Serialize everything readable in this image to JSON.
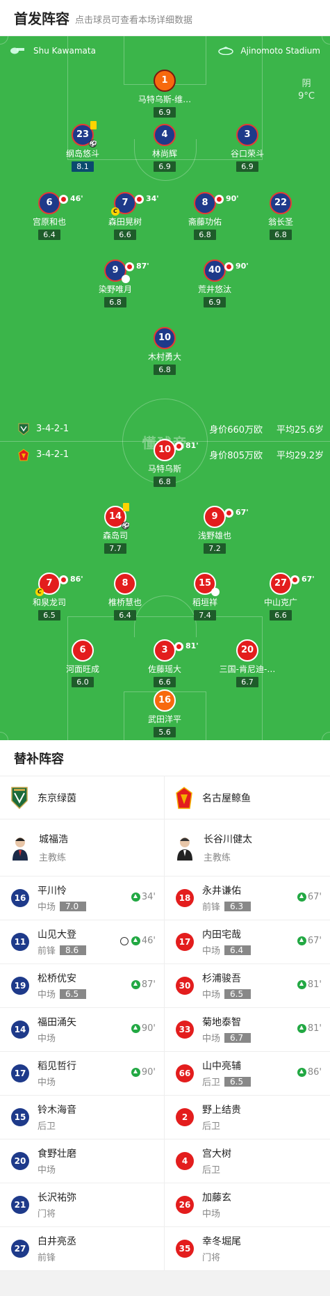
{
  "header": {
    "title": "首发阵容",
    "subtitle": "点击球员可查看本场详细数据"
  },
  "pitch": {
    "referee": "Shu Kawamata",
    "stadium": "Ajinomoto Stadium",
    "weather": "阴",
    "temperature": "9°C",
    "watermark": "懂球帝",
    "home_formation": {
      "formation": "3-4-2-1",
      "market_value": "身价660万欧",
      "avg_age": "平均25.6岁"
    },
    "away_formation": {
      "formation": "3-4-2-1",
      "market_value": "身价805万欧",
      "avg_age": "平均29.2岁"
    }
  },
  "home_players": [
    {
      "num": "1",
      "name": "马特乌斯-维…",
      "rating": "6.9"
    },
    {
      "num": "23",
      "name": "纲岛悠斗",
      "rating": "8.1"
    },
    {
      "num": "4",
      "name": "林尚辉",
      "rating": "6.9"
    },
    {
      "num": "3",
      "name": "谷口荣斗",
      "rating": "6.9"
    },
    {
      "num": "6",
      "name": "宫原和也",
      "rating": "6.4",
      "sub_min": "46'"
    },
    {
      "num": "7",
      "name": "森田晃树",
      "rating": "6.6",
      "sub_min": "34'"
    },
    {
      "num": "8",
      "name": "斋藤功佑",
      "rating": "6.8",
      "sub_min": "90'"
    },
    {
      "num": "22",
      "name": "翁长圣",
      "rating": "6.8"
    },
    {
      "num": "9",
      "name": "染野唯月",
      "rating": "6.8",
      "sub_min": "87'"
    },
    {
      "num": "40",
      "name": "荒井悠汰",
      "rating": "6.9",
      "sub_min": "90'"
    },
    {
      "num": "10",
      "name": "木村勇大",
      "rating": "6.8"
    }
  ],
  "away_players": [
    {
      "num": "10",
      "name": "马特乌斯",
      "rating": "6.8",
      "sub_min": "81'"
    },
    {
      "num": "14",
      "name": "森岛司",
      "rating": "7.7"
    },
    {
      "num": "9",
      "name": "浅野雄也",
      "rating": "7.2",
      "sub_min": "67'"
    },
    {
      "num": "7",
      "name": "和泉龙司",
      "rating": "6.5",
      "sub_min": "86'"
    },
    {
      "num": "8",
      "name": "椎桥慧也",
      "rating": "6.4"
    },
    {
      "num": "15",
      "name": "稻垣祥",
      "rating": "7.4"
    },
    {
      "num": "27",
      "name": "中山克广",
      "rating": "6.6",
      "sub_min": "67'"
    },
    {
      "num": "6",
      "name": "河面旺成",
      "rating": "6.0"
    },
    {
      "num": "3",
      "name": "佐藤瑶大",
      "rating": "6.6",
      "sub_min": "81'"
    },
    {
      "num": "20",
      "name": "三国-肯尼迪-…",
      "rating": "6.7"
    },
    {
      "num": "16",
      "name": "武田洋平",
      "rating": "5.6"
    }
  ],
  "subs": {
    "title": "替补阵容",
    "home_team": "东京绿茵",
    "away_team": "名古屋鲸鱼",
    "home_coach": {
      "name": "城福浩",
      "role": "主教练"
    },
    "away_coach": {
      "name": "长谷川健太",
      "role": "主教练"
    },
    "home": [
      {
        "num": "16",
        "name": "平川怜",
        "pos": "中场",
        "rating": "7.0",
        "min": "34'"
      },
      {
        "num": "11",
        "name": "山见大登",
        "pos": "前锋",
        "rating": "8.6",
        "min": "46'"
      },
      {
        "num": "19",
        "name": "松桥优安",
        "pos": "中场",
        "rating": "6.5",
        "min": "87'"
      },
      {
        "num": "14",
        "name": "福田涌矢",
        "pos": "中场",
        "rating": "",
        "min": "90'"
      },
      {
        "num": "17",
        "name": "稻见哲行",
        "pos": "中场",
        "rating": "",
        "min": "90'"
      },
      {
        "num": "15",
        "name": "铃木海音",
        "pos": "后卫",
        "rating": "",
        "min": ""
      },
      {
        "num": "20",
        "name": "食野壮磨",
        "pos": "中场",
        "rating": "",
        "min": ""
      },
      {
        "num": "21",
        "name": "长沢祐弥",
        "pos": "门将",
        "rating": "",
        "min": ""
      },
      {
        "num": "27",
        "name": "白井亮丞",
        "pos": "前锋",
        "rating": "",
        "min": ""
      }
    ],
    "away": [
      {
        "num": "18",
        "name": "永井谦佑",
        "pos": "前锋",
        "rating": "6.3",
        "min": "67'"
      },
      {
        "num": "17",
        "name": "内田宅哉",
        "pos": "中场",
        "rating": "6.4",
        "min": "67'"
      },
      {
        "num": "30",
        "name": "杉浦骏吾",
        "pos": "中场",
        "rating": "6.5",
        "min": "81'"
      },
      {
        "num": "33",
        "name": "菊地泰智",
        "pos": "中场",
        "rating": "6.7",
        "min": "81'"
      },
      {
        "num": "66",
        "name": "山中亮辅",
        "pos": "后卫",
        "rating": "6.5",
        "min": "86'"
      },
      {
        "num": "2",
        "name": "野上结贵",
        "pos": "后卫",
        "rating": "",
        "min": ""
      },
      {
        "num": "4",
        "name": "宫大树",
        "pos": "后卫",
        "rating": "",
        "min": ""
      },
      {
        "num": "26",
        "name": "加藤玄",
        "pos": "中场",
        "rating": "",
        "min": ""
      },
      {
        "num": "35",
        "name": "幸冬堀尾",
        "pos": "门将",
        "rating": "",
        "min": ""
      }
    ]
  },
  "colors": {
    "pitch": "#3bb54a",
    "home": "#1e3a8a",
    "away": "#e31d1d",
    "gk": "#f7690e",
    "up_arrow": "#22a843"
  }
}
